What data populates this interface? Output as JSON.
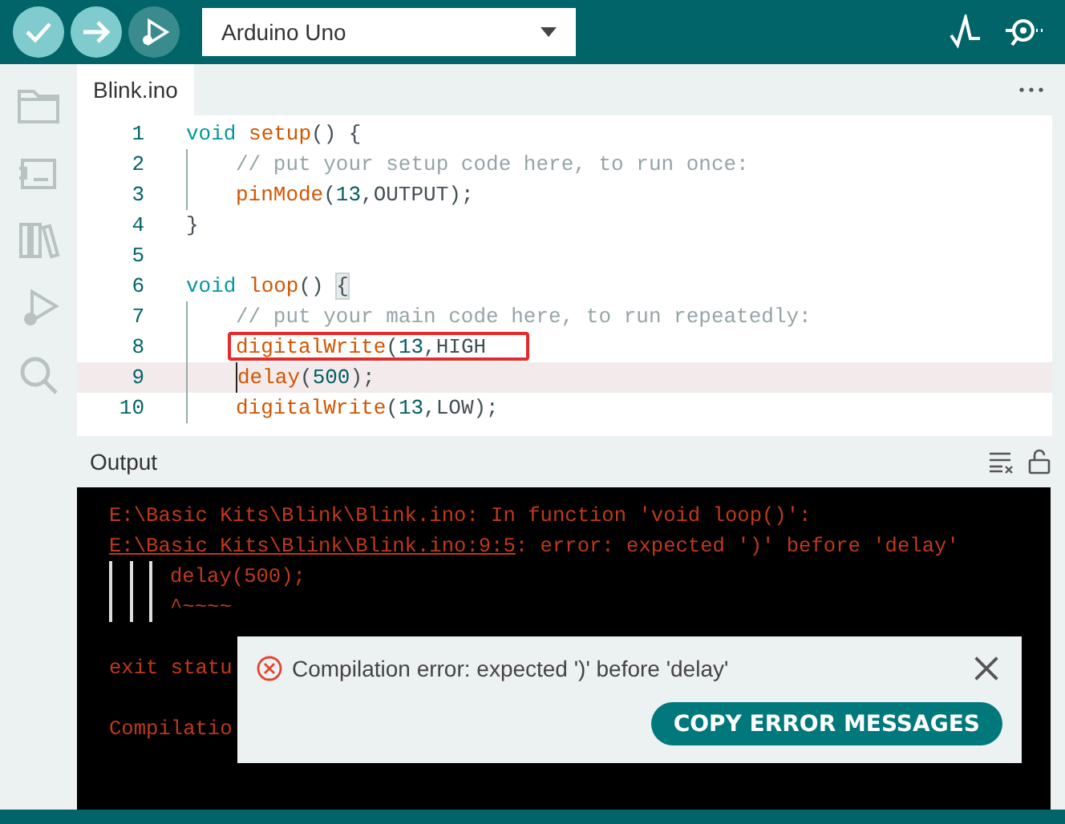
{
  "toolbar": {
    "buttons": [
      {
        "kind": "verify",
        "disabled": false
      },
      {
        "kind": "upload",
        "disabled": false
      },
      {
        "kind": "debug",
        "disabled": true
      }
    ],
    "board": "Arduino Uno"
  },
  "tabs": [
    {
      "label": "Blink.ino",
      "selected": true
    }
  ],
  "editor": {
    "lines": [
      {
        "number": "1",
        "current": false,
        "tokens": [
          {
            "text": "void ",
            "kind": "keyword"
          },
          {
            "text": "setup",
            "kind": "function"
          },
          {
            "text": "() {",
            "kind": "plain"
          }
        ],
        "children": [
          {
            "number": "2",
            "current": false,
            "tokens": [
              {
                "text": "// put your setup code here, to run once:",
                "kind": "comment"
              }
            ]
          },
          {
            "number": "3",
            "current": false,
            "tokens": [
              {
                "text": "pinMode",
                "kind": "function"
              },
              {
                "text": "(",
                "kind": "plain"
              },
              {
                "text": "13",
                "kind": "number"
              },
              {
                "text": ",OUTPUT);",
                "kind": "plain"
              }
            ]
          }
        ]
      },
      {
        "number": "4",
        "current": false,
        "tokens": [
          {
            "text": "}",
            "kind": "plain"
          }
        ]
      },
      {
        "number": "5",
        "current": false
      },
      {
        "number": "6",
        "current": false,
        "tokens": [
          {
            "text": "void ",
            "kind": "keyword"
          },
          {
            "text": "loop",
            "kind": "function"
          },
          {
            "text": "() ",
            "kind": "plain"
          },
          {
            "text": "{",
            "kind": "bracket"
          }
        ],
        "children": [
          {
            "number": "7",
            "current": false,
            "tokens": [
              {
                "text": "// put your main code here, to run repeatedly:",
                "kind": "comment"
              }
            ]
          },
          {
            "number": "8",
            "current": false,
            "marked": true,
            "tokens": [
              {
                "text": "digitalWrite",
                "kind": "function"
              },
              {
                "text": "(",
                "kind": "plain"
              },
              {
                "text": "13",
                "kind": "number"
              },
              {
                "text": ",HIGH",
                "kind": "plain"
              }
            ]
          },
          {
            "number": "9",
            "current": true,
            "tokens": [
              {
                "text": "delay",
                "kind": "function"
              },
              {
                "text": "(",
                "kind": "plain"
              },
              {
                "text": "500",
                "kind": "number"
              },
              {
                "text": ");",
                "kind": "plain"
              }
            ]
          },
          {
            "number": "10",
            "current": false,
            "tokens": [
              {
                "text": "digitalWrite",
                "kind": "function"
              },
              {
                "text": "(",
                "kind": "plain"
              },
              {
                "text": "13",
                "kind": "number"
              },
              {
                "text": ",LOW);",
                "kind": "plain"
              }
            ]
          }
        ]
      }
    ]
  },
  "output": {
    "title": "Output",
    "lines": [
      {
        "kind": "text",
        "text": "E:\\Basic Kits\\Blink\\Blink.ino: In function 'void loop()':"
      },
      {
        "kind": "link",
        "link": "E:\\Basic Kits\\Blink\\Blink.ino:9:5",
        "text": ": error: expected ')' before 'delay'"
      },
      {
        "kind": "source",
        "text": "delay(500);"
      },
      {
        "kind": "source",
        "text": "^~~~~"
      },
      {
        "kind": "blank"
      },
      {
        "kind": "text",
        "text": "exit statu"
      },
      {
        "kind": "blank"
      },
      {
        "kind": "text",
        "text": "Compilatio"
      }
    ]
  },
  "toast": {
    "message": "Compilation error: expected ')' before 'delay'",
    "button": "COPY ERROR MESSAGES"
  }
}
